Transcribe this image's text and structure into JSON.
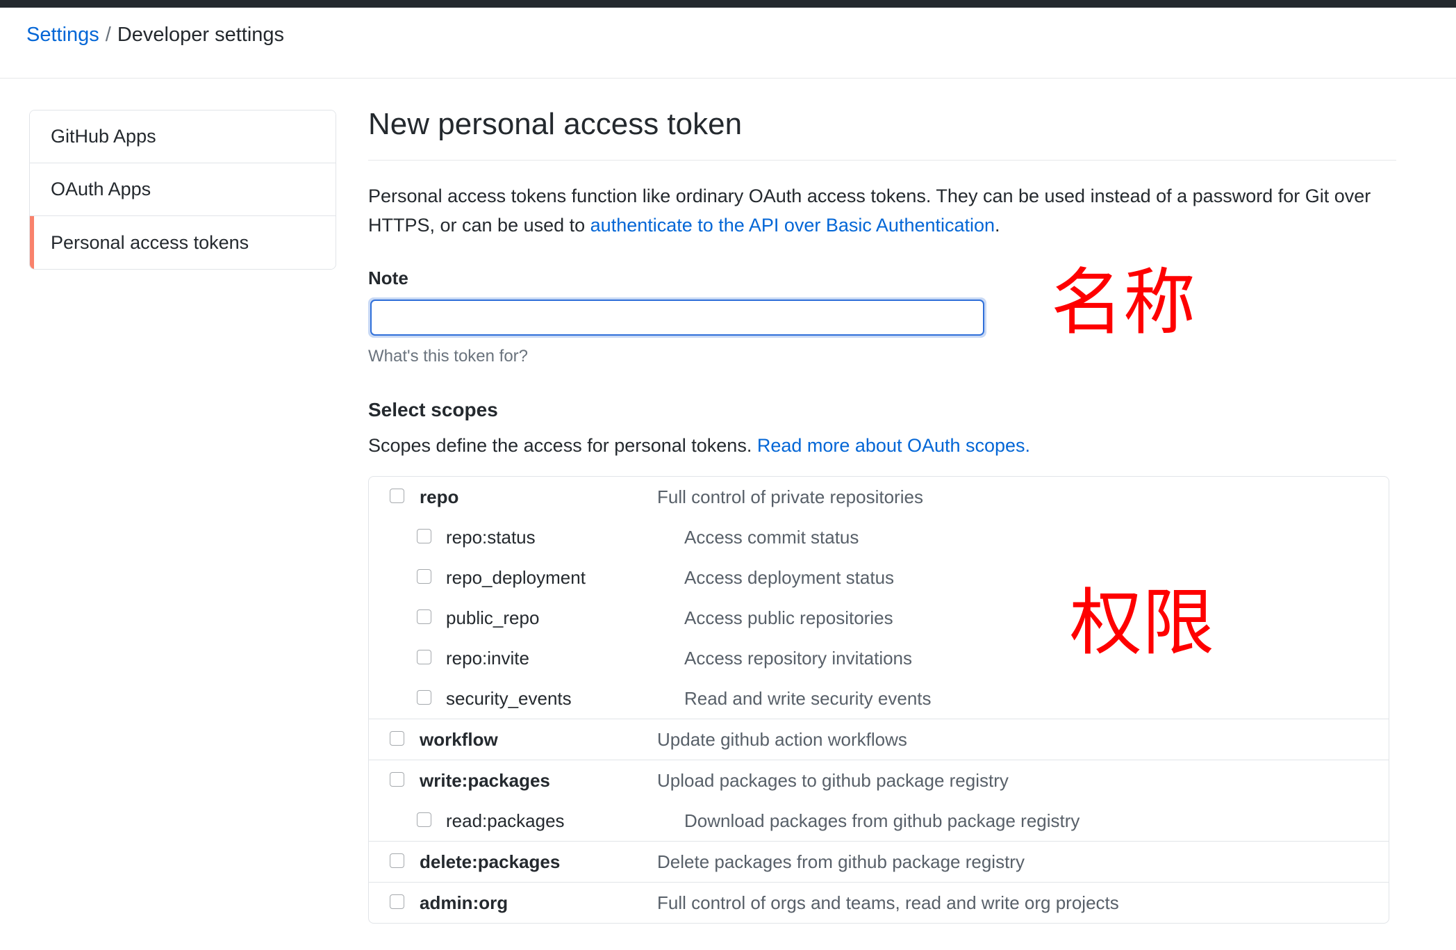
{
  "breadcrumb": {
    "root": "Settings",
    "separator": "/",
    "current": "Developer settings"
  },
  "sidebar": {
    "items": [
      {
        "label": "GitHub Apps",
        "selected": false
      },
      {
        "label": "OAuth Apps",
        "selected": false
      },
      {
        "label": "Personal access tokens",
        "selected": true
      }
    ],
    "accent_color": "#f9826c"
  },
  "main": {
    "title": "New personal access token",
    "intro_before_link": "Personal access tokens function like ordinary OAuth access tokens. They can be used instead of a password for Git over HTTPS, or can be used to ",
    "intro_link": "authenticate to the API over Basic Authentication",
    "intro_after_link": ".",
    "note": {
      "label": "Note",
      "value": "",
      "placeholder": "",
      "help": "What's this token for?",
      "focused": true,
      "focus_border_color": "#2f6fd9"
    },
    "scopes": {
      "section_title": "Select scopes",
      "desc_before_link": "Scopes define the access for personal tokens. ",
      "desc_link": "Read more about OAuth scopes.",
      "groups": [
        {
          "rows": [
            {
              "name": "repo",
              "desc": "Full control of private repositories",
              "level": "parent",
              "checked": false
            },
            {
              "name": "repo:status",
              "desc": "Access commit status",
              "level": "child",
              "checked": false
            },
            {
              "name": "repo_deployment",
              "desc": "Access deployment status",
              "level": "child",
              "checked": false
            },
            {
              "name": "public_repo",
              "desc": "Access public repositories",
              "level": "child",
              "checked": false
            },
            {
              "name": "repo:invite",
              "desc": "Access repository invitations",
              "level": "child",
              "checked": false
            },
            {
              "name": "security_events",
              "desc": "Read and write security events",
              "level": "child",
              "checked": false
            }
          ]
        },
        {
          "rows": [
            {
              "name": "workflow",
              "desc": "Update github action workflows",
              "level": "parent",
              "checked": false
            }
          ]
        },
        {
          "rows": [
            {
              "name": "write:packages",
              "desc": "Upload packages to github package registry",
              "level": "parent",
              "checked": false
            },
            {
              "name": "read:packages",
              "desc": "Download packages from github package registry",
              "level": "child",
              "checked": false
            }
          ]
        },
        {
          "rows": [
            {
              "name": "delete:packages",
              "desc": "Delete packages from github package registry",
              "level": "parent",
              "checked": false
            }
          ]
        },
        {
          "rows": [
            {
              "name": "admin:org",
              "desc": "Full control of orgs and teams, read and write org projects",
              "level": "parent",
              "checked": false
            }
          ]
        }
      ]
    }
  },
  "annotations": {
    "color": "#fe0000",
    "name_label": "名称",
    "permission_label": "权限"
  },
  "link_color": "#0366d6"
}
